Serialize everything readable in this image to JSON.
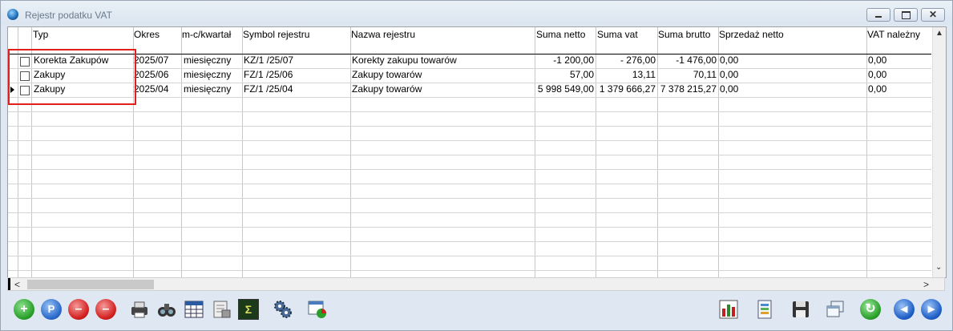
{
  "window": {
    "title": "Rejestr podatku VAT"
  },
  "titlebar_buttons": {
    "minimize": "▭",
    "maximize": "▢",
    "close": "✕"
  },
  "columns": [
    "Typ",
    "Okres",
    "m-c/kwartał",
    "Symbol rejestru",
    "Nazwa rejestru",
    "Suma  netto",
    "Suma  vat",
    "Suma  brutto",
    "Sprzedaż netto",
    "VAT należny"
  ],
  "rows": [
    {
      "typ": "Korekta Zakupów",
      "okres": "2025/07",
      "mc": "miesięczny",
      "symbol": "KZ/1  /25/07",
      "nazwa": "Korekty zakupu towarów",
      "netto": "-1 200,00",
      "vat": "- 276,00",
      "brutto": "-1 476,00",
      "sprzedaz": "0,00",
      "vatnal": "0,00"
    },
    {
      "typ": "Zakupy",
      "okres": "2025/06",
      "mc": "miesięczny",
      "symbol": "FZ/1  /25/06",
      "nazwa": "Zakupy towarów",
      "netto": "57,00",
      "vat": "13,11",
      "brutto": "70,11",
      "sprzedaz": "0,00",
      "vatnal": "0,00"
    },
    {
      "typ": "Zakupy",
      "okres": "2025/04",
      "mc": "miesięczny",
      "symbol": "FZ/1  /25/04",
      "nazwa": "Zakupy towarów",
      "netto": "5 998 549,00",
      "vat": "1 379 666,27",
      "brutto": "7 378 215,27",
      "sprzedaz": "0,00",
      "vatnal": "0,00"
    }
  ],
  "scroll": {
    "up": "▲",
    "down": "⌄",
    "left": "<",
    "right": ">"
  },
  "toolbar": {
    "add_icon": "plus-circle-icon",
    "add_symbol": "+",
    "find_icon": "search-person-icon",
    "find_symbol": "P",
    "delete_icon": "minus-circle-icon",
    "delete_symbol": "–",
    "delete_confirm_icon": "minus-check-icon",
    "delete_confirm_symbol": "–",
    "print_icon": "printer-icon",
    "binoculars_icon": "binoculars-icon",
    "calculator_icon": "table-calc-icon",
    "document_icon": "document-scale-icon",
    "sum_icon": "sum-icon",
    "sum_symbol": "Σ",
    "gear_icon": "gears-icon",
    "chart_icon": "window-chart-icon",
    "report_icon": "bar-chart-icon",
    "notes_icon": "notes-icon",
    "save_icon": "floppy-icon",
    "windows_icon": "cascade-windows-icon",
    "refresh_icon": "refresh-icon",
    "refresh_symbol": "↻",
    "prev_icon": "previous-icon",
    "prev_symbol": "◀",
    "next_icon": "next-icon",
    "next_symbol": "▶"
  },
  "colors": {
    "selection_box": "#e0201c",
    "add": "#2aa02a",
    "delete": "#d42020",
    "nav": "#1f5fc8"
  }
}
